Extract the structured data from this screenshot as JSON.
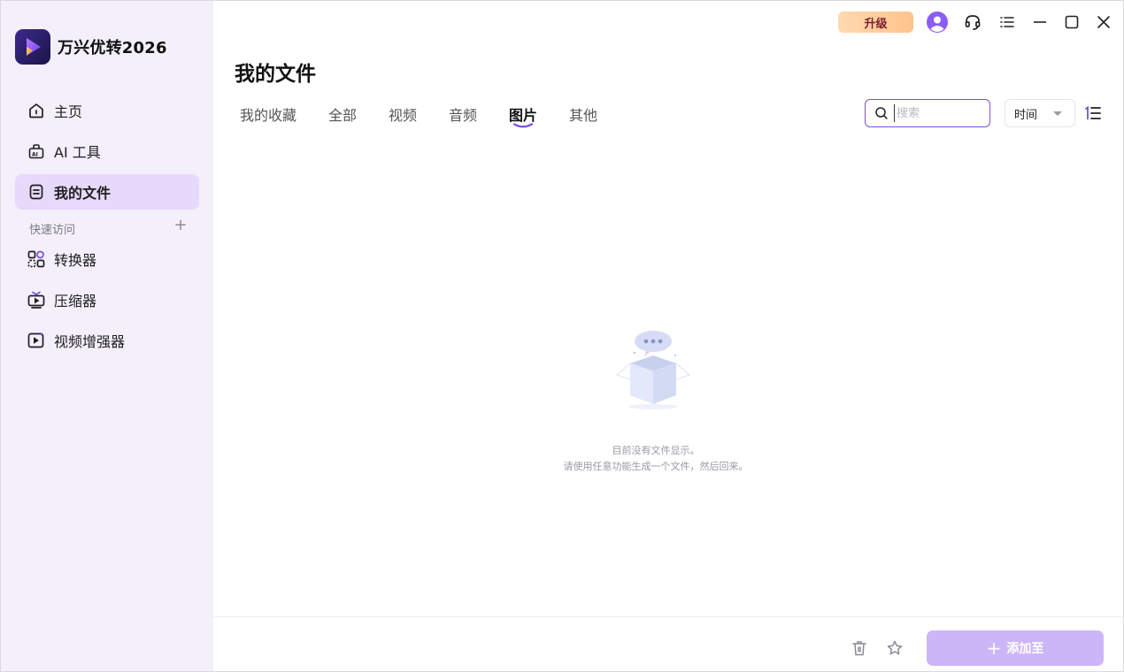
{
  "app": {
    "name": "万兴优转2026",
    "upgrade_label": "升级",
    "accent_color": "#7b4fe0"
  },
  "sidebar": {
    "items": [
      {
        "label": "主页",
        "icon": "home-icon"
      },
      {
        "label": "AI 工具",
        "icon": "ai-tools-icon"
      },
      {
        "label": "我的文件",
        "icon": "file-icon",
        "active": true
      }
    ],
    "quick_access_label": "快速访问",
    "quick_items": [
      {
        "label": "转换器",
        "icon": "converter-icon"
      },
      {
        "label": "压缩器",
        "icon": "compressor-icon"
      },
      {
        "label": "视频增强器",
        "icon": "video-enhancer-icon"
      }
    ]
  },
  "main": {
    "title": "我的文件",
    "tabs": [
      {
        "label": "我的收藏"
      },
      {
        "label": "全部"
      },
      {
        "label": "视频"
      },
      {
        "label": "音频"
      },
      {
        "label": "图片",
        "active": true
      },
      {
        "label": "其他"
      }
    ],
    "search": {
      "placeholder": "搜索",
      "value": ""
    },
    "sort": {
      "selected": "时间"
    },
    "empty": {
      "line1": "目前没有文件显示。",
      "line2": "请使用任意功能生成一个文件，然后回来。"
    }
  },
  "footer": {
    "add_label": "添加至",
    "add_button_color": "#cdb6f7"
  }
}
